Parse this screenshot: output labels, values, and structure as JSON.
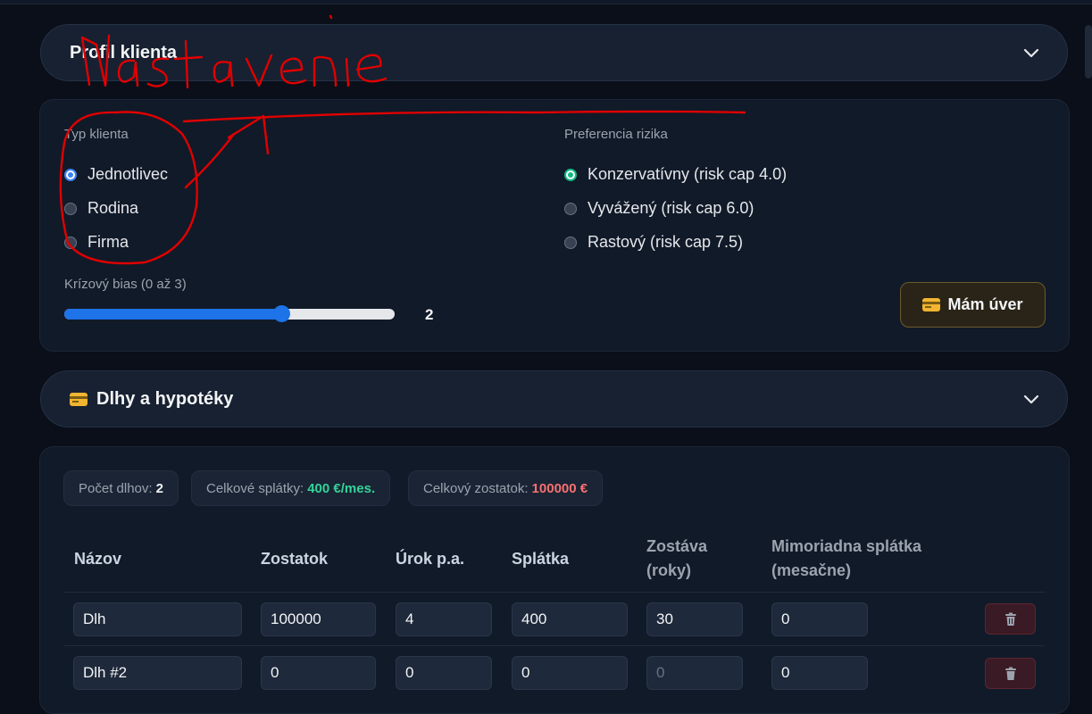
{
  "profile": {
    "header_title": "Profil klienta",
    "client_type_label": "Typ klienta",
    "client_types": [
      "Jednotlivec",
      "Rodina",
      "Firma"
    ],
    "client_type_selected": "Jednotlivec",
    "risk_label": "Preferencia rizika",
    "risk_options": [
      "Konzervatívny (risk cap 4.0)",
      "Vyvážený (risk cap 6.0)",
      "Rastový (risk cap 7.5)"
    ],
    "risk_selected": "Konzervatívny (risk cap 4.0)",
    "crisis_label": "Krízový bias (0 až 3)",
    "crisis_value": "2",
    "crisis_min": 0,
    "crisis_max": 3,
    "loan_button": "Mám úver"
  },
  "debts": {
    "header_title": "Dlhy a hypotéky",
    "count_label": "Počet dlhov:",
    "count_value": "2",
    "payments_label": "Celkové splátky:",
    "payments_value": "400 €/mes.",
    "balance_label": "Celkový zostatok:",
    "balance_value": "100000 €",
    "columns": {
      "name": "Názov",
      "balance": "Zostatok",
      "rate": "Úrok p.a.",
      "payment": "Splátka",
      "remaining_1": "Zostáva",
      "remaining_2": "(roky)",
      "extra_1": "Mimoriadna splátka",
      "extra_2": "(mesačne)"
    },
    "rows": [
      {
        "name": "Dlh",
        "balance": "100000",
        "rate": "4",
        "payment": "400",
        "remaining": "30",
        "extra": "0"
      },
      {
        "name": "Dlh #2",
        "balance": "0",
        "rate": "0",
        "payment": "0",
        "remaining": "0",
        "extra": "0"
      }
    ]
  },
  "annotation_text": "Nastavenie",
  "colors": {
    "accent_blue": "#1e73e8",
    "accent_green": "#10b981",
    "positive": "#34d399",
    "negative": "#f87171",
    "annotation": "#e00000"
  },
  "icons": [
    "credit-card-icon",
    "chevron-down-icon",
    "trash-icon"
  ]
}
